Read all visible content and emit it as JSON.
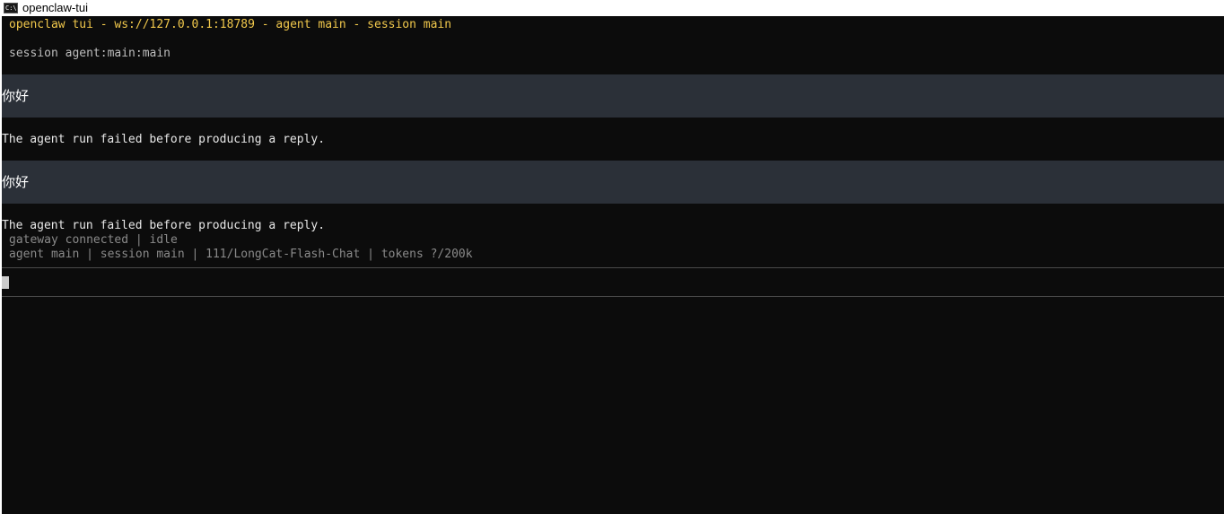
{
  "window": {
    "title": "openclaw-tui",
    "icon": "console-icon",
    "icon_glyph": "C:\\"
  },
  "header": {
    "text": "openclaw tui - ws://127.0.0.1:18789 - agent main - session main"
  },
  "session": {
    "text": "session agent:main:main"
  },
  "messages": [
    {
      "role": "user",
      "text": "你好"
    },
    {
      "role": "agent",
      "text": "The agent run failed before producing a reply."
    },
    {
      "role": "user",
      "text": "你好"
    },
    {
      "role": "agent",
      "text": "The agent run failed before producing a reply."
    }
  ],
  "status": {
    "line1": "gateway connected | idle",
    "line2": "agent main | session main | 111/LongCat-Flash-Chat | tokens ?/200k"
  },
  "colors": {
    "background": "#0c0c0c",
    "header_accent": "#f2c94c",
    "user_block": "#2b3038",
    "status_text": "#8a8a8a"
  }
}
